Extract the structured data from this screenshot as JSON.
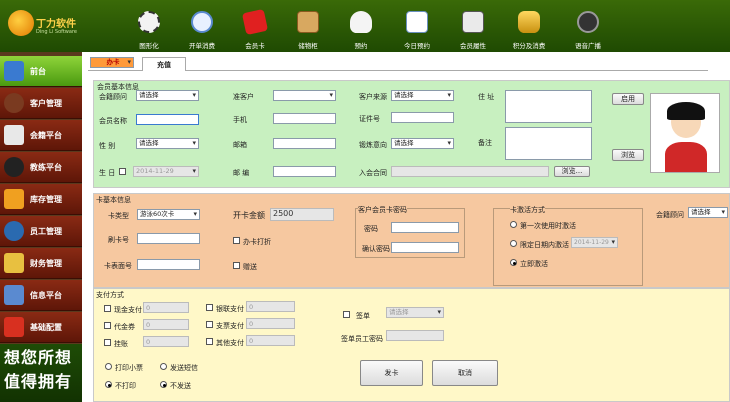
{
  "app": {
    "logo_title": "丁力软件",
    "logo_sub": "Ding Li Software"
  },
  "topnav": [
    {
      "label": "图形化",
      "icon": "puzzle-icon"
    },
    {
      "label": "开单消费",
      "icon": "magnifier-icon"
    },
    {
      "label": "会员卡",
      "icon": "red-card-icon"
    },
    {
      "label": "储物柜",
      "icon": "box-icon"
    },
    {
      "label": "预约",
      "icon": "ghost-icon"
    },
    {
      "label": "今日预约",
      "icon": "search-doc-icon"
    },
    {
      "label": "会员履性",
      "icon": "portrait-icon"
    },
    {
      "label": "积分及消费",
      "icon": "coins-icon"
    },
    {
      "label": "语音广播",
      "icon": "satellite-icon"
    }
  ],
  "sidebar": {
    "items": [
      {
        "label": "前台",
        "active": true
      },
      {
        "label": "客户管理",
        "active": false
      },
      {
        "label": "会籍平台",
        "active": false
      },
      {
        "label": "教练平台",
        "active": false
      },
      {
        "label": "库存管理",
        "active": false
      },
      {
        "label": "员工管理",
        "active": false
      },
      {
        "label": "财务管理",
        "active": false
      },
      {
        "label": "信息平台",
        "active": false
      },
      {
        "label": "基础配置",
        "active": false
      }
    ],
    "slogan_line1": "想您所想",
    "slogan_line2": "值得拥有"
  },
  "tabs": [
    {
      "label": "办卡",
      "selected": true
    },
    {
      "label": "充值",
      "selected": false
    }
  ],
  "member_basic": {
    "section_title": "会员基本信息",
    "consultant_label": "会籍顾问",
    "consultant_value": "请选择",
    "prospect_label": "准客户",
    "prospect_value": "",
    "source_label": "客户来源",
    "source_value": "请选择",
    "address_label": "住 址",
    "name_label": "会员名称",
    "phone_label": "手机",
    "id_label": "证件号",
    "gender_label": "性 别",
    "gender_value": "请选择",
    "email_label": "邮箱",
    "exercise_label": "锻炼意向",
    "exercise_value": "请选择",
    "remark_label": "备注",
    "birthday_label": "生 日",
    "birthday_value": "2014-11-29",
    "postcode_label": "邮 编",
    "contract_label": "入会合同",
    "browse_label": "浏览...",
    "enable_btn": "启用",
    "browse_btn": "浏览"
  },
  "card_basic": {
    "section_title": "卡基本信息",
    "card_type_label": "卡类型",
    "card_type_value": "游泳60次卡",
    "card_no_label": "刷卡号",
    "card_face_label": "卡表面号",
    "amount_label": "开卡金额",
    "amount_value": "2500",
    "discount_label": "办卡打折",
    "gift_label": "赠送",
    "password_group_title": "客户会员卡密码",
    "password_label": "密码",
    "confirm_label": "确认密码",
    "activation_title": "卡激活方式",
    "activation_first": "第一次使用时激活",
    "activation_date": "限定日期内激活",
    "activation_date_value": "2014-11-29",
    "activation_now": "立即激活",
    "consultant_label": "会籍顾问",
    "consultant_value": "请选择"
  },
  "payment": {
    "section_title": "支付方式",
    "cash_label": "现金支付",
    "cash_value": "0",
    "bank_label": "银联支付",
    "bank_value": "0",
    "coupon_label": "代金券",
    "coupon_value": "0",
    "check_label": "支票支付",
    "check_value": "0",
    "installment_label": "挂账",
    "installment_value": "0",
    "other_label": "其他支付",
    "other_value": "0",
    "sign_label": "签单",
    "sign_value": "请选择",
    "sign_staff_label": "签单员工密码",
    "print_label": "打印小票",
    "no_print_label": "不打印",
    "send_sms_label": "发送短信",
    "no_send_label": "不发送",
    "submit_btn": "发卡",
    "cancel_btn": "取消"
  }
}
